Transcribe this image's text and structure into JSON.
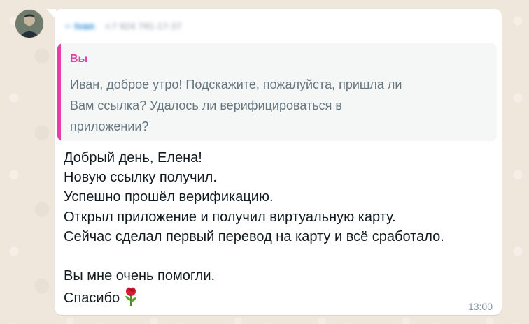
{
  "chat": {
    "sender_name": "~ Ivan",
    "sender_phone": "+7 924 791-17-37",
    "time": "13:00"
  },
  "reply_quote": {
    "author": "Вы",
    "lines": [
      "Иван, доброе утро! Подскажите, пожалуйста, пришла ли",
      "Вам ссылка? Удалось ли верифицироваться в",
      "приложении?"
    ]
  },
  "message": {
    "lines": [
      "Добрый день, Елена!",
      "Новую ссылку получил.",
      "Успешно прошёл верификацию.",
      "Открыл приложение и получил виртуальную карту.",
      "Сейчас сделал первый перевод на карту и всё сработало.",
      "",
      "Вы мне очень помогли.",
      "Спасибо"
    ],
    "emoji_icon": "rose-icon"
  },
  "colors": {
    "quote_accent": "#e73fa5",
    "sender_name": "#2f8fd6",
    "timestamp": "#8696a0",
    "chat_background": "#efe7dc"
  }
}
